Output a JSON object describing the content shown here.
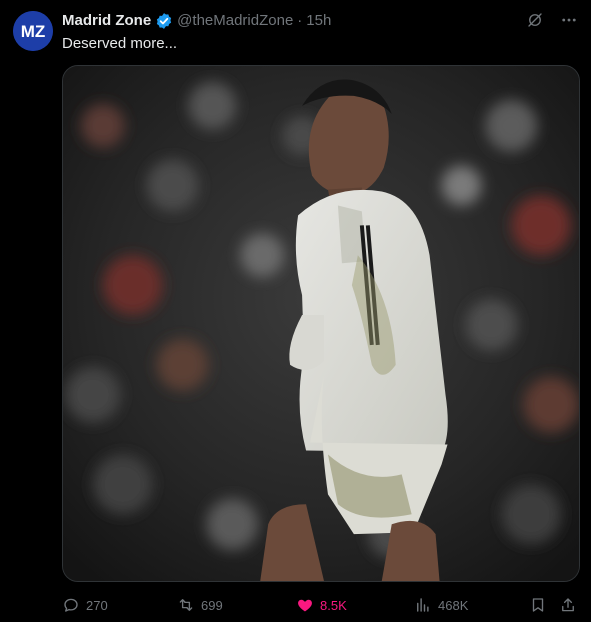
{
  "tweet": {
    "avatar_text": "MZ",
    "display_name": "Madrid Zone",
    "handle": "@theMadridZone",
    "separator": "·",
    "time": "15h",
    "text": "Deserved more..."
  },
  "metrics": {
    "replies": "270",
    "retweets": "699",
    "likes": "8.5K",
    "views": "468K"
  },
  "colors": {
    "background": "#000000",
    "text_primary": "#e7e9ea",
    "text_secondary": "#71767b",
    "verified": "#1d9bf0",
    "like": "#f91880",
    "avatar_bg": "#1d3ea8"
  },
  "icons": {
    "top": [
      "grok-icon",
      "more-icon"
    ],
    "actions": [
      "reply-icon",
      "retweet-icon",
      "heart-icon",
      "views-icon",
      "bookmark-icon",
      "share-icon"
    ]
  }
}
